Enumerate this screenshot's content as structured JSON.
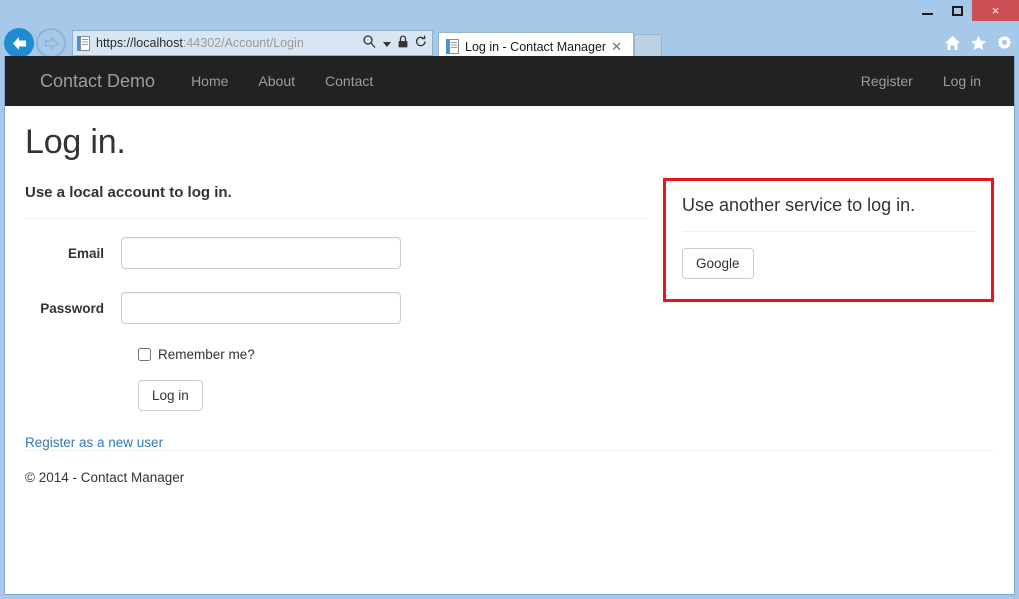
{
  "window": {
    "minimize_label": "Minimize",
    "maximize_label": "Maximize",
    "close_label": "×"
  },
  "browser": {
    "back_label": "←",
    "forward_label": "→",
    "address": {
      "url_secure_part": "https://localhost",
      "url_rest": ":44302/Account/Login",
      "full_url": "https://localhost:44302/Account/Login",
      "search_icon": "search-icon",
      "dropdown_icon": "▾",
      "lock_icon": "lock-icon",
      "refresh_icon": "↻"
    },
    "tab": {
      "title": "Log in - Contact Manager",
      "close_label": "✕"
    },
    "toolbar_icons": [
      "home-icon",
      "favorites-star-icon",
      "settings-gear-icon"
    ]
  },
  "site_nav": {
    "brand": "Contact Demo",
    "links": [
      {
        "label": "Home"
      },
      {
        "label": "About"
      },
      {
        "label": "Contact"
      }
    ],
    "right_links": [
      {
        "label": "Register"
      },
      {
        "label": "Log in"
      }
    ]
  },
  "main": {
    "page_title": "Log in.",
    "local_section": {
      "lead": "Use a local account to log in.",
      "fields": [
        {
          "label": "Email",
          "value": "",
          "placeholder": ""
        },
        {
          "label": "Password",
          "value": "",
          "placeholder": ""
        }
      ],
      "remember_label": "Remember me?",
      "remember_checked": false,
      "submit_label": "Log in",
      "register_link": "Register as a new user"
    },
    "external_section": {
      "title": "Use another service to log in.",
      "providers": [
        {
          "label": "Google"
        }
      ],
      "highlight_color": "#e8131d"
    }
  },
  "footer": {
    "copyright": "© 2014 - Contact Manager"
  }
}
